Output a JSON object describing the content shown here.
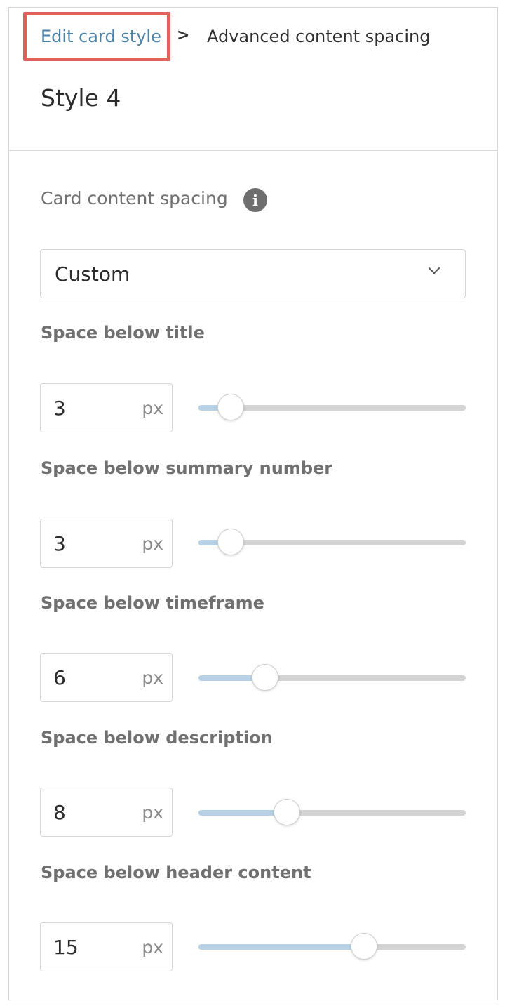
{
  "breadcrumb": {
    "link_label": "Edit card style",
    "separator": ">",
    "current_label": "Advanced content spacing"
  },
  "page_title": "Style 4",
  "spacing_section": {
    "label": "Card content spacing",
    "info_icon": "i",
    "select_value": "Custom"
  },
  "fields": [
    {
      "label": "Space below title",
      "value": "3",
      "unit": "px",
      "slider_fraction": 0.12
    },
    {
      "label": "Space below summary number",
      "value": "3",
      "unit": "px",
      "slider_fraction": 0.12
    },
    {
      "label": "Space below timeframe",
      "value": "6",
      "unit": "px",
      "slider_fraction": 0.25
    },
    {
      "label": "Space below description",
      "value": "8",
      "unit": "px",
      "slider_fraction": 0.33
    },
    {
      "label": "Space below header content",
      "value": "15",
      "unit": "px",
      "slider_fraction": 0.62
    }
  ],
  "colors": {
    "link": "#4b82a8",
    "highlight_border": "#e0625c",
    "slider_fill": "#b7d2e6",
    "slider_track": "#d3d3d3"
  }
}
